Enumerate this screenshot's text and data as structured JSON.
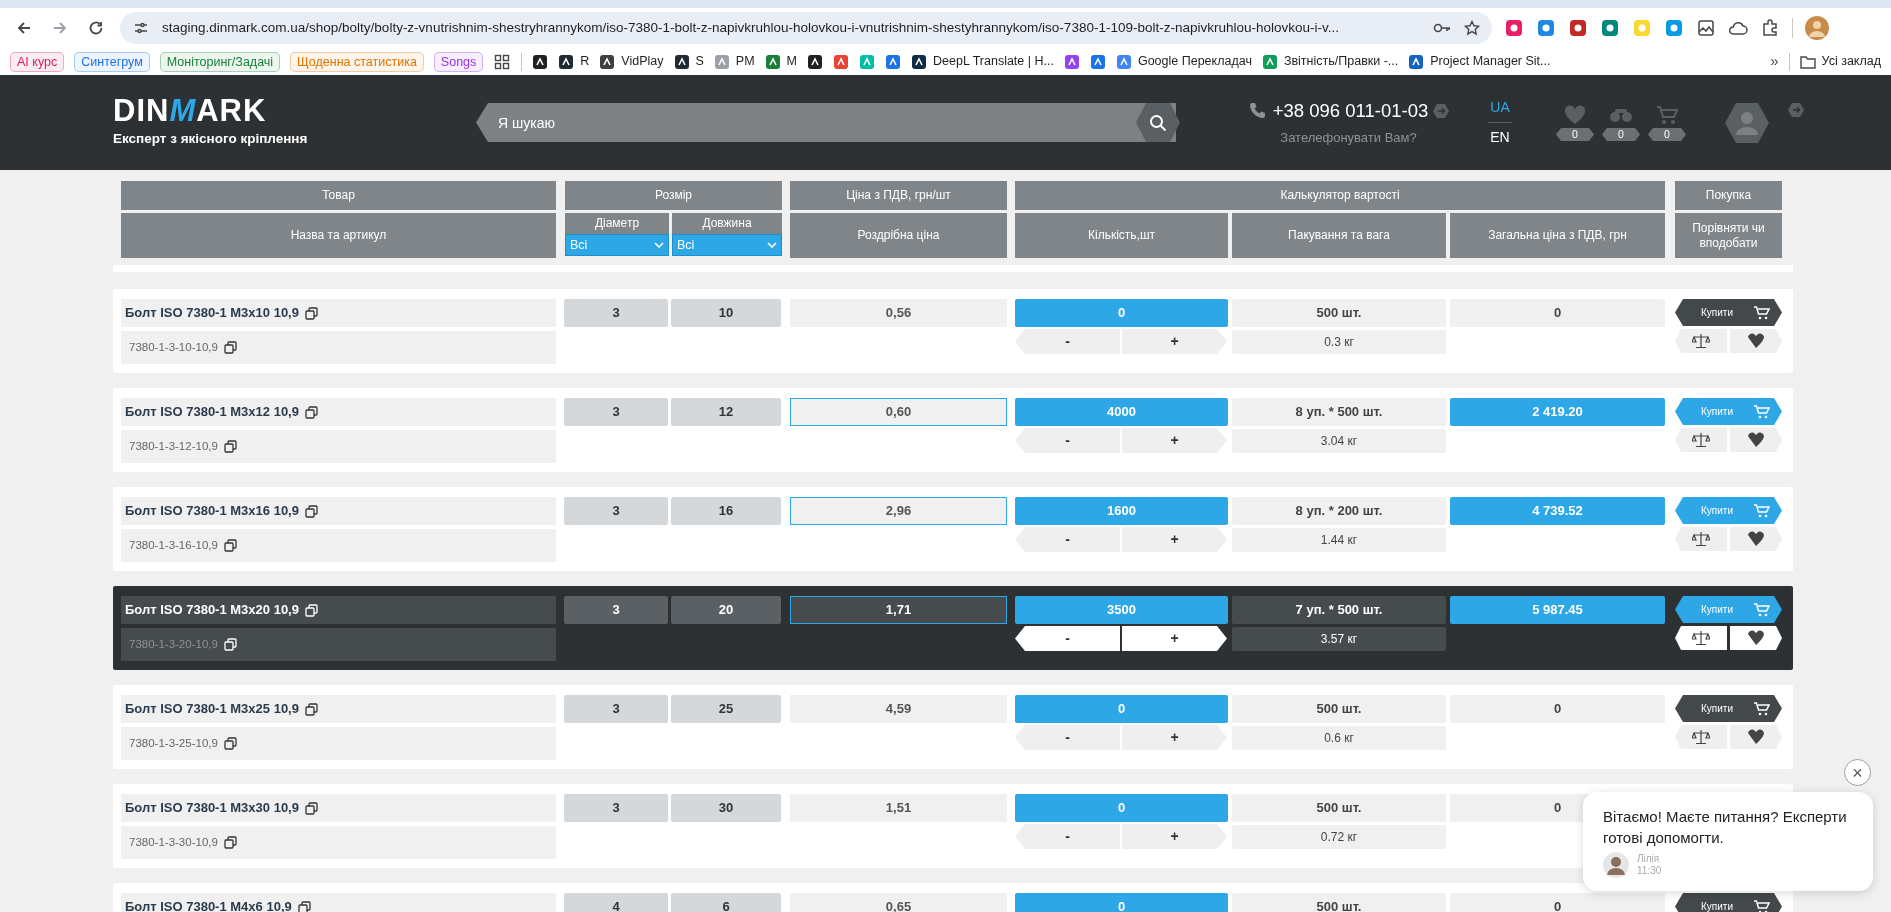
{
  "browser": {
    "url": "staging.dinmark.com.ua/shop/bolty/bolty-z-vnutrishnim-shestryhrannykom/iso-7380-1-bolt-z-napivkruhlou-holovkou-i-vnutrishnim-shestyhrannykom/iso-7380-1-109-bolt-z-napivkruhlou-holovkou-i-v...",
    "bookmarks": [
      {
        "kind": "tag",
        "label": "AI курс",
        "color": "#d81b60"
      },
      {
        "kind": "tag",
        "label": "Синтегрум",
        "color": "#1a73e8"
      },
      {
        "kind": "tag",
        "label": "Моніторинг/Задачі",
        "color": "#188038"
      },
      {
        "kind": "tag",
        "label": "Щоденна статистика",
        "color": "#e37400"
      },
      {
        "kind": "tag",
        "label": "Songs",
        "color": "#9334e6"
      },
      {
        "kind": "apps"
      },
      {
        "kind": "site",
        "color": "#202124"
      },
      {
        "kind": "site",
        "label": "R",
        "color": "#1f2a36"
      },
      {
        "kind": "site",
        "label": "VidPlay",
        "color": "#3c4043"
      },
      {
        "kind": "site",
        "label": "S",
        "color": "#1f2a36"
      },
      {
        "kind": "site",
        "label": "PM",
        "color": "#9aa0a6"
      },
      {
        "kind": "site",
        "label": "M",
        "color": "#188038"
      },
      {
        "kind": "site",
        "color": "#202124"
      },
      {
        "kind": "site",
        "color": "#ea4335"
      },
      {
        "kind": "site",
        "color": "#00bfa5"
      },
      {
        "kind": "site",
        "color": "#1a73e8"
      },
      {
        "kind": "site",
        "label": "DeepL Translate | H...",
        "color": "#0f2b46"
      },
      {
        "kind": "site",
        "color": "#8e44ef"
      },
      {
        "kind": "site",
        "color": "#1a73e8"
      },
      {
        "kind": "site",
        "label": "Google Перекладач",
        "color": "#4285f4"
      },
      {
        "kind": "site",
        "label": "Звітність/Правки -...",
        "color": "#0f9d58"
      },
      {
        "kind": "site",
        "label": "Project Manager Sit...",
        "color": "#1565c0"
      }
    ],
    "more": "»",
    "all_bookmarks": "Усі заклад"
  },
  "header": {
    "logo": {
      "start": "DIN",
      "accent": "M",
      "end": "ARK"
    },
    "tagline": "Експерт з якісного кріплення",
    "search_placeholder": "Я шукаю",
    "phone": "+38 096 011-01-03",
    "callback": "Зателефонувати Вам?",
    "languages": [
      {
        "label": "UA",
        "selected": true
      },
      {
        "label": "EN",
        "selected": false
      }
    ],
    "counters": [
      {
        "kind": "wishlist",
        "count": "0"
      },
      {
        "kind": "compare",
        "count": "0"
      },
      {
        "kind": "cart",
        "count": "0"
      }
    ]
  },
  "table": {
    "header": {
      "product": "Товар",
      "product_sub": "Назва та артикул",
      "size": "Розмір",
      "diameter": "Діаметр",
      "length": "Довжина",
      "diameter_filter": "Всі",
      "length_filter": "Всі",
      "price": "Ціна з ПДВ, грн/шт",
      "price_sub": "Роздрібна ціна",
      "calculator": "Калькулятор вартості",
      "quantity": "Кількість,шт",
      "packing": "Пакування та вага",
      "total": "Загальна ціна з ПДВ, грн",
      "purchase": "Покупка",
      "purchase_sub": "Порівняти чи вподобати"
    },
    "rows": [
      {
        "name": "Болт ISO 7380-1 M3x10 10,9",
        "code": "7380-1-3-10-10,9",
        "diameter": "3",
        "length": "10",
        "price": "0,56",
        "quantity": "0",
        "minus": "-",
        "plus": "+",
        "packing": "500 шт.",
        "weight": "0.3 кг",
        "total": "0",
        "buy": "Купити",
        "in_cart": false,
        "selected": false
      },
      {
        "name": "Болт ISO 7380-1 M3x12 10,9",
        "code": "7380-1-3-12-10,9",
        "diameter": "3",
        "length": "12",
        "price": "0,60",
        "quantity": "4000",
        "minus": "-",
        "plus": "+",
        "packing": "8 уп. * 500 шт.",
        "weight": "3.04 кг",
        "total": "2 419.20",
        "buy": "Купити",
        "in_cart": true,
        "selected": false
      },
      {
        "name": "Болт ISO 7380-1 M3x16 10,9",
        "code": "7380-1-3-16-10,9",
        "diameter": "3",
        "length": "16",
        "price": "2,96",
        "quantity": "1600",
        "minus": "-",
        "plus": "+",
        "packing": "8 уп. * 200 шт.",
        "weight": "1.44 кг",
        "total": "4 739.52",
        "buy": "Купити",
        "in_cart": true,
        "selected": false
      },
      {
        "name": "Болт ISO 7380-1 M3x20 10,9",
        "code": "7380-1-3-20-10,9",
        "diameter": "3",
        "length": "20",
        "price": "1,71",
        "quantity": "3500",
        "minus": "-",
        "plus": "+",
        "packing": "7 уп. * 500 шт.",
        "weight": "3.57 кг",
        "total": "5 987.45",
        "buy": "Купити",
        "in_cart": true,
        "selected": true
      },
      {
        "name": "Болт ISO 7380-1 M3x25 10,9",
        "code": "7380-1-3-25-10,9",
        "diameter": "3",
        "length": "25",
        "price": "4,59",
        "quantity": "0",
        "minus": "-",
        "plus": "+",
        "packing": "500 шт.",
        "weight": "0.6 кг",
        "total": "0",
        "buy": "Купити",
        "in_cart": false,
        "selected": false
      },
      {
        "name": "Болт ISO 7380-1 M3x30 10,9",
        "code": "7380-1-3-30-10,9",
        "diameter": "3",
        "length": "30",
        "price": "1,51",
        "quantity": "0",
        "minus": "-",
        "plus": "+",
        "packing": "500 шт.",
        "weight": "0.72 кг",
        "total": "0",
        "in_cart": false,
        "selected": false
      },
      {
        "name": "Болт ISO 7380-1 M4x6 10,9",
        "diameter": "4",
        "length": "6",
        "price": "0,65",
        "quantity": "0",
        "packing": "500 шт.",
        "total": "0",
        "buy": "Купити",
        "in_cart": false,
        "selected": false
      }
    ]
  },
  "chat": {
    "close": "×",
    "message": "Вітаємо! Маєте питання? Експерти готові допомогти.",
    "agent": "Лілія",
    "time": "11:30"
  }
}
